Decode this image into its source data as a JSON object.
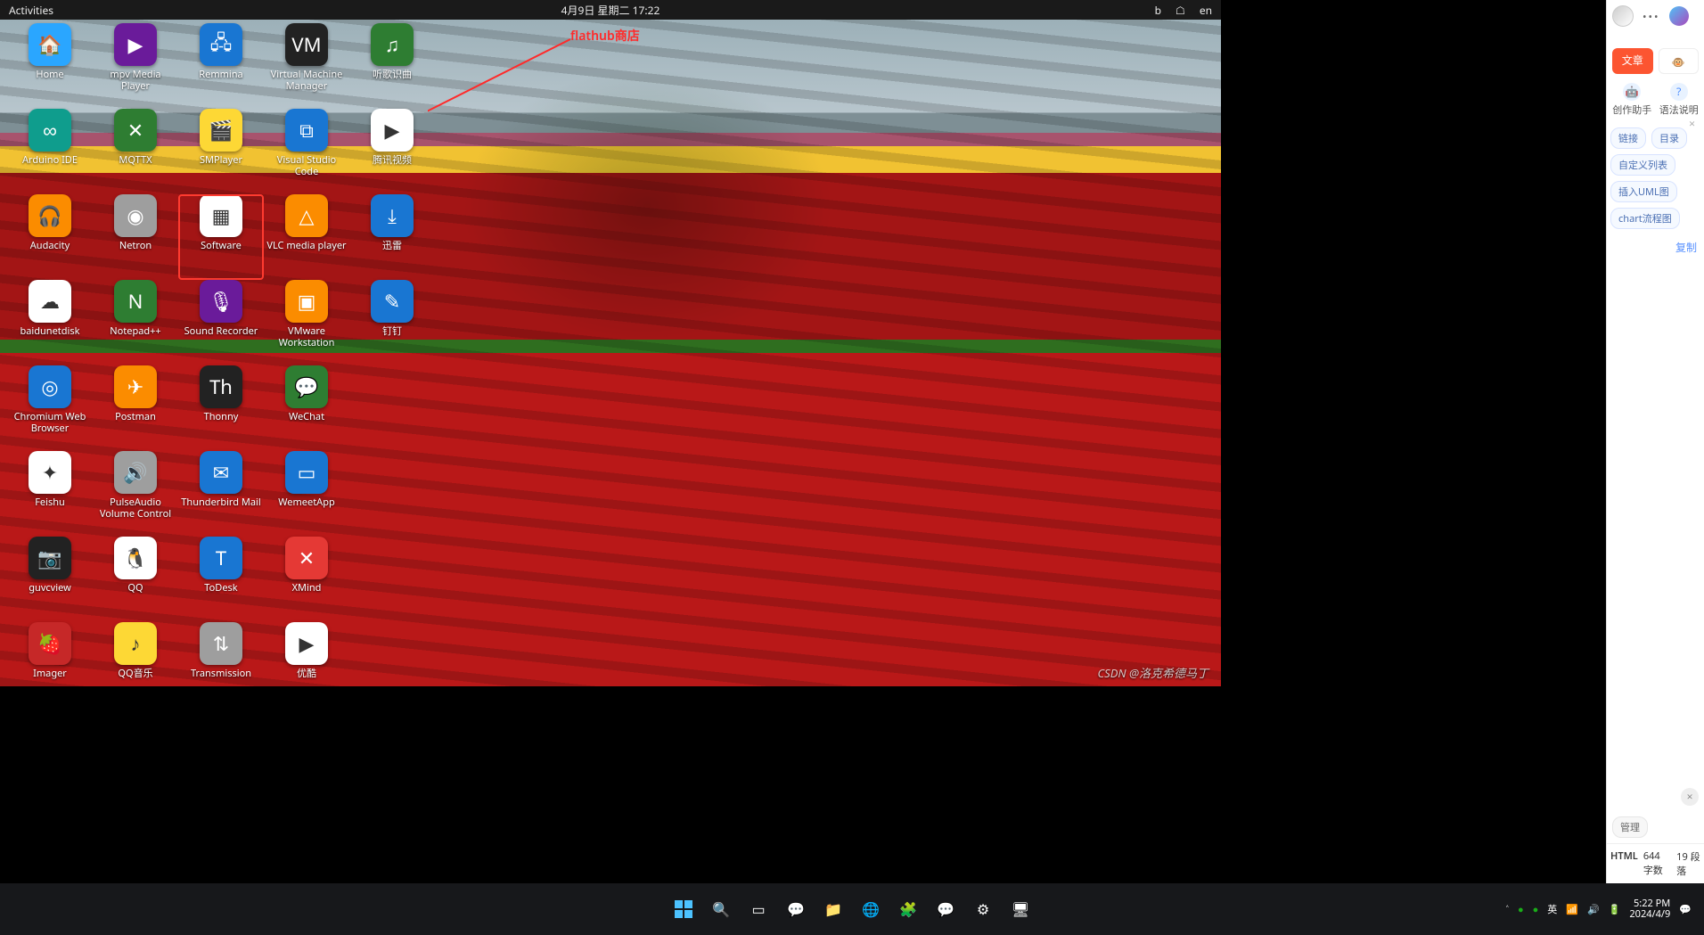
{
  "gnome": {
    "top": {
      "activities": "Activities",
      "datetime": "4月9日 星期二  17:22",
      "lang": "en"
    },
    "icons": [
      {
        "id": "home",
        "label": "Home",
        "bg": "folder",
        "glyph": "🏠"
      },
      {
        "id": "mpv",
        "label": "mpv Media Player",
        "bg": "purple",
        "glyph": "▶"
      },
      {
        "id": "remmina",
        "label": "Remmina",
        "bg": "blue",
        "glyph": "🖧"
      },
      {
        "id": "virt-manager",
        "label": "Virtual Machine Manager",
        "bg": "black",
        "glyph": "VM"
      },
      {
        "id": "listen",
        "label": "听歌识曲",
        "bg": "green",
        "glyph": "♫"
      },
      {
        "id": "arduino",
        "label": "Arduino IDE",
        "bg": "teal",
        "glyph": "∞"
      },
      {
        "id": "mqttx",
        "label": "MQTTX",
        "bg": "green",
        "glyph": "✕"
      },
      {
        "id": "smplayer",
        "label": "SMPlayer",
        "bg": "yellow",
        "glyph": "🎬"
      },
      {
        "id": "vscode",
        "label": "Visual Studio Code",
        "bg": "blue",
        "glyph": "⧉"
      },
      {
        "id": "tencent-video",
        "label": "腾讯视频",
        "bg": "white",
        "glyph": "▶"
      },
      {
        "id": "audacity",
        "label": "Audacity",
        "bg": "orange",
        "glyph": "🎧"
      },
      {
        "id": "netron",
        "label": "Netron",
        "bg": "grey",
        "glyph": "◉"
      },
      {
        "id": "software",
        "label": "Software",
        "bg": "white",
        "glyph": "▦",
        "highlight": true
      },
      {
        "id": "vlc",
        "label": "VLC media player",
        "bg": "orange",
        "glyph": "△"
      },
      {
        "id": "xunlei",
        "label": "迅雷",
        "bg": "blue",
        "glyph": "⤓"
      },
      {
        "id": "baidunetdisk",
        "label": "baidunetdisk",
        "bg": "white",
        "glyph": "☁"
      },
      {
        "id": "notepadpp",
        "label": "Notepad++",
        "bg": "green",
        "glyph": "N"
      },
      {
        "id": "sound-recorder",
        "label": "Sound Recorder",
        "bg": "purple",
        "glyph": "🎙"
      },
      {
        "id": "vmware",
        "label": "VMware Workstation",
        "bg": "orange",
        "glyph": "▣"
      },
      {
        "id": "dingtalk",
        "label": "钉钉",
        "bg": "blue",
        "glyph": "✎"
      },
      {
        "id": "chromium",
        "label": "Chromium Web Browser",
        "bg": "blue",
        "glyph": "◎"
      },
      {
        "id": "postman",
        "label": "Postman",
        "bg": "orange",
        "glyph": "✈"
      },
      {
        "id": "thonny",
        "label": "Thonny",
        "bg": "black",
        "glyph": "Th"
      },
      {
        "id": "wechat",
        "label": "WeChat",
        "bg": "green",
        "glyph": "💬"
      },
      {
        "id": "blank1",
        "label": "",
        "bg": "",
        "glyph": ""
      },
      {
        "id": "feishu",
        "label": "Feishu",
        "bg": "white",
        "glyph": "✦"
      },
      {
        "id": "pulseaudio",
        "label": "PulseAudio Volume Control",
        "bg": "grey",
        "glyph": "🔊"
      },
      {
        "id": "thunderbird",
        "label": "Thunderbird Mail",
        "bg": "blue",
        "glyph": "✉"
      },
      {
        "id": "wemeet",
        "label": "WemeetApp",
        "bg": "blue",
        "glyph": "▭"
      },
      {
        "id": "blank2",
        "label": "",
        "bg": "",
        "glyph": ""
      },
      {
        "id": "guvcview",
        "label": "guvcview",
        "bg": "black",
        "glyph": "📷"
      },
      {
        "id": "qq",
        "label": "QQ",
        "bg": "white",
        "glyph": "🐧"
      },
      {
        "id": "todesk",
        "label": "ToDesk",
        "bg": "blue",
        "glyph": "T"
      },
      {
        "id": "xmind",
        "label": "XMind",
        "bg": "red",
        "glyph": "✕"
      },
      {
        "id": "blank3",
        "label": "",
        "bg": "",
        "glyph": ""
      },
      {
        "id": "imager",
        "label": "Imager",
        "bg": "pink",
        "glyph": "🍓"
      },
      {
        "id": "qqmusic",
        "label": "QQ音乐",
        "bg": "yellow",
        "glyph": "♪"
      },
      {
        "id": "transmission",
        "label": "Transmission",
        "bg": "grey",
        "glyph": "⇅"
      },
      {
        "id": "youku",
        "label": "优酷",
        "bg": "white",
        "glyph": "▶"
      },
      {
        "id": "blank4",
        "label": "",
        "bg": "",
        "glyph": ""
      }
    ],
    "annotation": {
      "text": "flathub商店"
    },
    "watermark": "CSDN @洛克希德马丁"
  },
  "side": {
    "tabs": {
      "primary": "文章",
      "emoji": "🐵"
    },
    "help": {
      "left": "创作助手",
      "right": "语法说明"
    },
    "close": "×",
    "chips1": [
      "链接",
      "目录",
      "自定义列表",
      "插入UML图",
      "chart流程图"
    ],
    "copy": "复制",
    "chips2": [
      "管理"
    ],
    "closecircle": "×",
    "status": {
      "format": "HTML",
      "words_label": "字数",
      "words": "644",
      "paras_label": "段落",
      "paras": "19"
    }
  },
  "taskbar": {
    "center_icons": [
      "start",
      "search",
      "taskview",
      "chat",
      "explorer",
      "edge",
      "store",
      "wechat",
      "settings",
      "extra",
      "extra2"
    ],
    "tray": {
      "ime": "英",
      "time": "5:22 PM",
      "date": "2024/4/9"
    }
  }
}
